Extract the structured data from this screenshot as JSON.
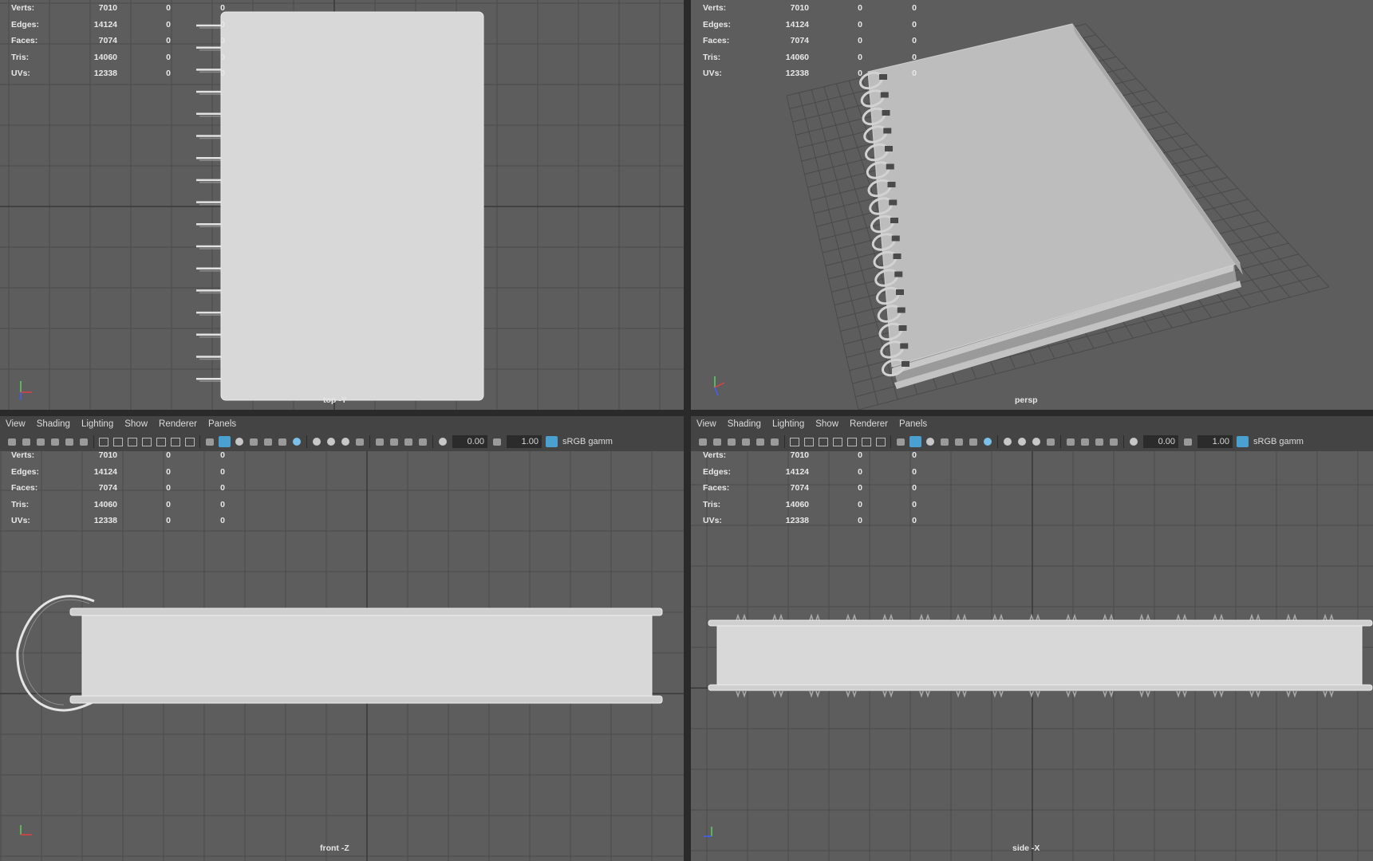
{
  "viewports": {
    "top": {
      "camera": "top -Y"
    },
    "persp": {
      "camera": "persp"
    },
    "front": {
      "camera": "front -Z"
    },
    "side": {
      "camera": "side -X"
    }
  },
  "hud_stats": [
    {
      "label": "Verts:",
      "v1": "7010",
      "v2": "0",
      "v3": "0"
    },
    {
      "label": "Edges:",
      "v1": "14124",
      "v2": "0",
      "v3": "0"
    },
    {
      "label": "Faces:",
      "v1": "7074",
      "v2": "0",
      "v3": "0"
    },
    {
      "label": "Tris:",
      "v1": "14060",
      "v2": "0",
      "v3": "0"
    },
    {
      "label": "UVs:",
      "v1": "12338",
      "v2": "0",
      "v3": "0"
    }
  ],
  "menu": [
    "View",
    "Shading",
    "Lighting",
    "Show",
    "Renderer",
    "Panels"
  ],
  "toolbar": {
    "exposure": "0.00",
    "gamma": "1.00",
    "color_space": "sRGB gamm"
  },
  "colors": {
    "viewport_bg": "#5d5d5d",
    "grid_line": "#4c4c4c",
    "grid_axis": "#383838",
    "model": "#d8d8d8",
    "panel": "#444444"
  }
}
